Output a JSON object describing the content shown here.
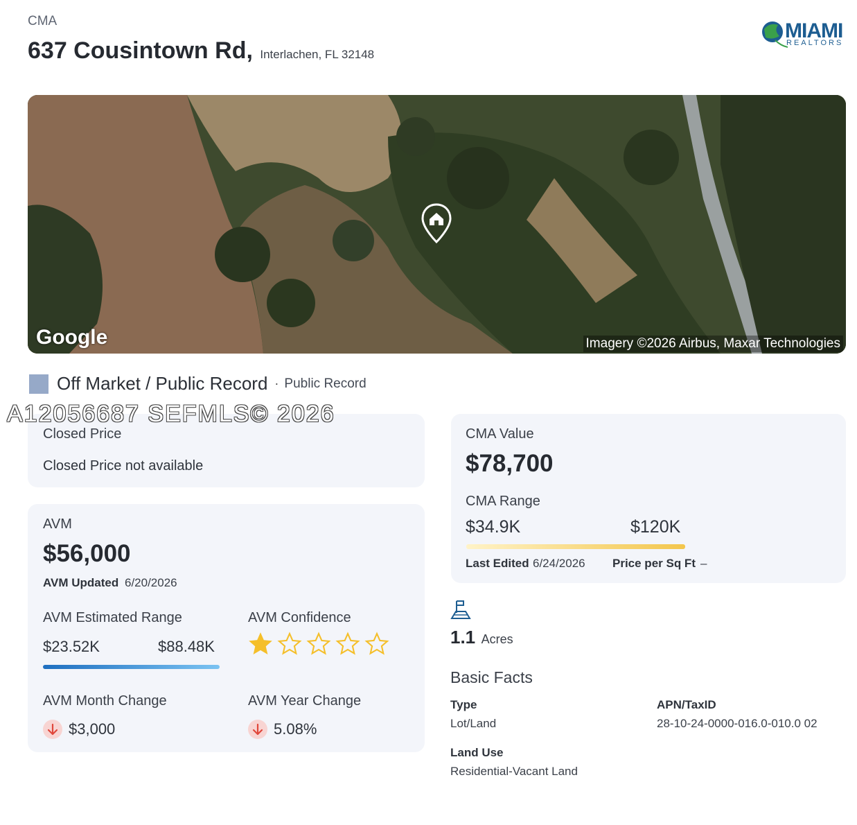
{
  "header": {
    "label": "CMA",
    "street": "637 Cousintown Rd,",
    "city": "Interlachen, FL 32148",
    "logo_text": "MIAMI",
    "logo_sub": "REALTORS"
  },
  "map": {
    "provider": "Google",
    "attribution": "Imagery ©2026 Airbus, Maxar Technologies",
    "pin_icon": "home-pin-icon"
  },
  "status": {
    "main": "Off Market / Public Record",
    "separator": "·",
    "sub": "Public Record",
    "color": "#96a9c8"
  },
  "watermark": "A12056687  SEFMLS© 2026",
  "closed_price": {
    "label": "Closed Price",
    "value": "Closed Price not available"
  },
  "avm": {
    "label": "AVM",
    "value": "$56,000",
    "updated_label": "AVM Updated",
    "updated_date": "6/20/2026",
    "range_label": "AVM Estimated Range",
    "range_low": "$23.52K",
    "range_high": "$88.48K",
    "confidence_label": "AVM Confidence",
    "confidence_stars": 1,
    "confidence_max": 5,
    "month_change_label": "AVM Month Change",
    "month_change_value": "$3,000",
    "year_change_label": "AVM Year Change",
    "year_change_value": "5.08%",
    "down_color": "#e0473b"
  },
  "cma": {
    "value_label": "CMA Value",
    "value": "$78,700",
    "range_label": "CMA Range",
    "range_low": "$34.9K",
    "range_high": "$120K",
    "last_edited_label": "Last Edited",
    "last_edited_date": "6/24/2026",
    "price_sqft_label": "Price per Sq Ft",
    "price_sqft_value": "–"
  },
  "lot": {
    "icon": "land-flag-icon",
    "acres": "1.1",
    "unit": "Acres"
  },
  "basic_facts": {
    "title": "Basic Facts",
    "type_label": "Type",
    "type_value": "Lot/Land",
    "apn_label": "APN/TaxID",
    "apn_value": "28-10-24-0000-016.0-010.0 02",
    "land_use_label": "Land Use",
    "land_use_value": "Residential-Vacant Land"
  }
}
